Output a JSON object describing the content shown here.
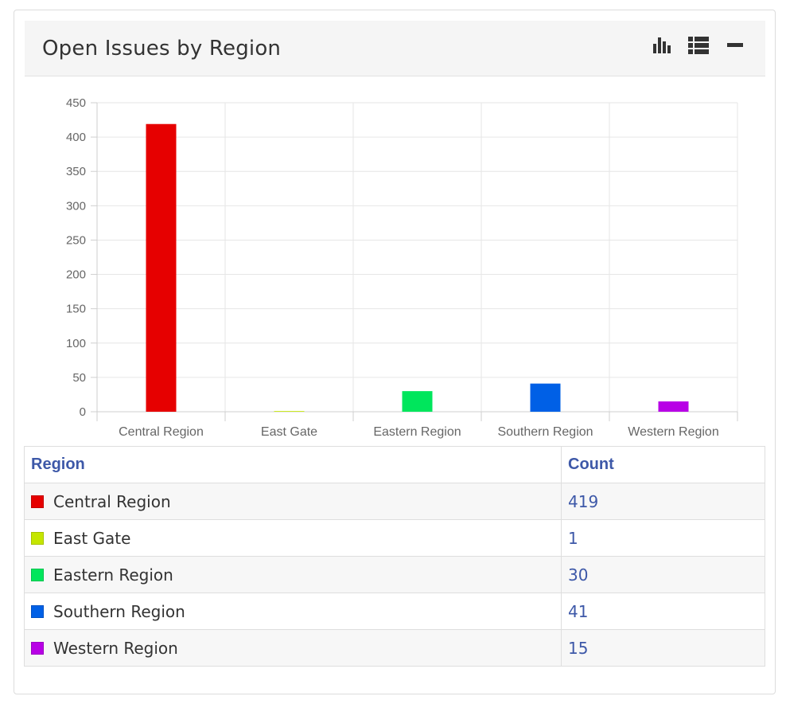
{
  "panel": {
    "title": "Open Issues by Region",
    "tools": [
      {
        "name": "bar-chart-icon"
      },
      {
        "name": "list-icon"
      },
      {
        "name": "minimize-icon"
      }
    ]
  },
  "chart_data": {
    "type": "bar",
    "title": "",
    "xlabel": "",
    "ylabel": "",
    "categories": [
      "Central Region",
      "East Gate",
      "Eastern Region",
      "Southern Region",
      "Western Region"
    ],
    "values": [
      419,
      1,
      30,
      41,
      15
    ],
    "colors": [
      "#e60000",
      "#c5e600",
      "#00e65c",
      "#0060e6",
      "#b800e6"
    ],
    "ylim": [
      0,
      450
    ],
    "yticks": [
      "0",
      "50",
      "100",
      "150",
      "200",
      "250",
      "300",
      "350",
      "400",
      "450"
    ],
    "grid": true,
    "legend": "none"
  },
  "table": {
    "headers": {
      "region": "Region",
      "count": "Count"
    },
    "rows": [
      {
        "region": "Central Region",
        "count": "419",
        "color": "#e60000"
      },
      {
        "region": "East Gate",
        "count": "1",
        "color": "#c5e600"
      },
      {
        "region": "Eastern Region",
        "count": "30",
        "color": "#00e65c"
      },
      {
        "region": "Southern Region",
        "count": "41",
        "color": "#0060e6"
      },
      {
        "region": "Western Region",
        "count": "15",
        "color": "#b800e6"
      }
    ]
  }
}
